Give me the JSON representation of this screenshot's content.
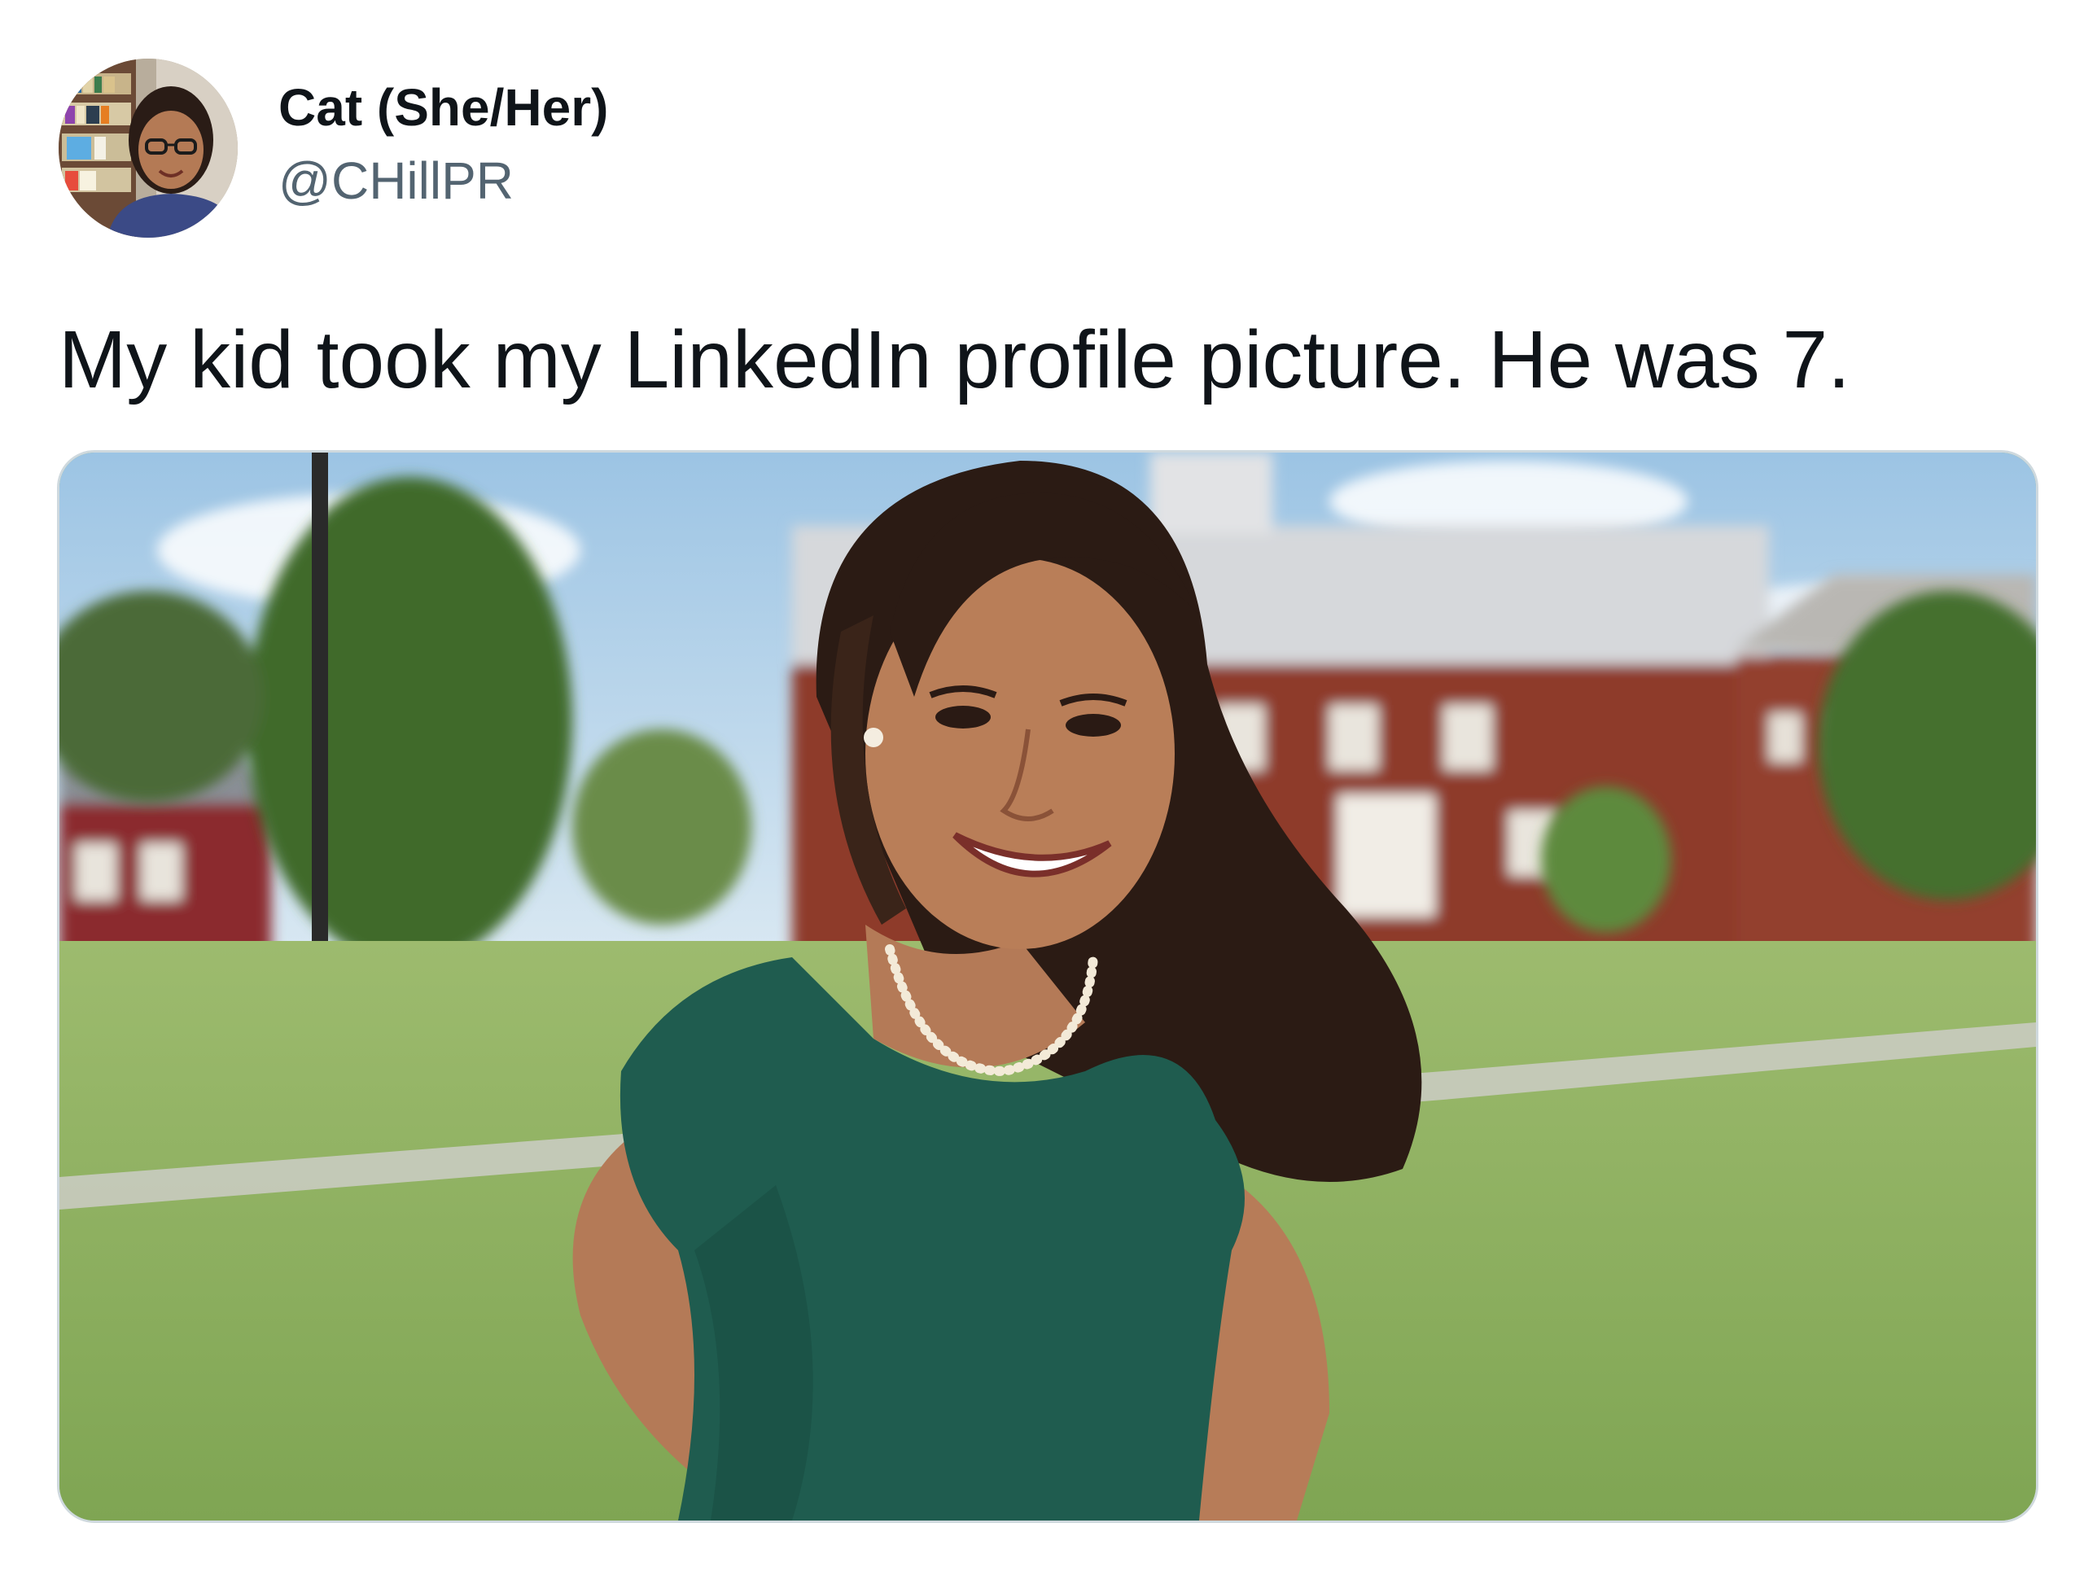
{
  "author": {
    "display_name": "Cat (She/Her)",
    "handle": "@CHillPR",
    "avatar_icon": "profile-avatar"
  },
  "tweet": {
    "text": "My kid took my LinkedIn profile picture. He was 7."
  },
  "media": {
    "kind": "photo",
    "icon": "photo-image"
  },
  "colors": {
    "text_primary": "#0f1419",
    "text_secondary": "#536471",
    "media_border": "#cfd9de"
  }
}
